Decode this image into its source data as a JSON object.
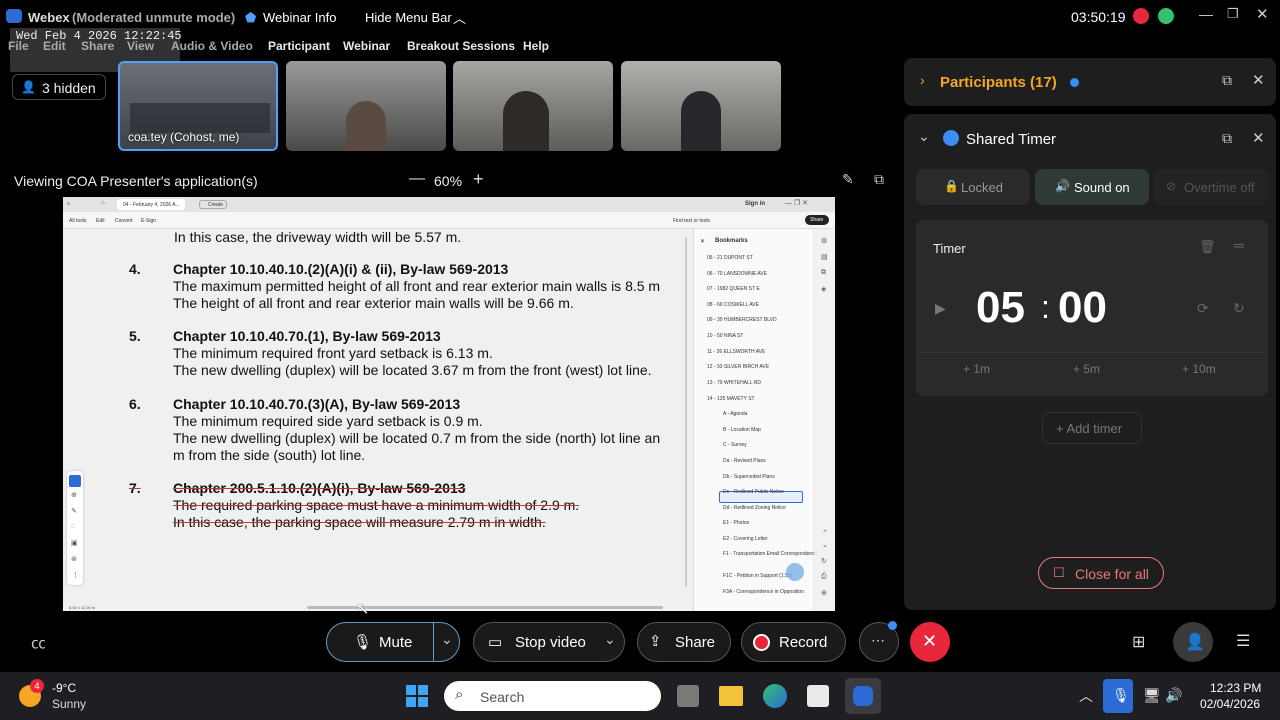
{
  "titlebar": {
    "app": "Webex",
    "mode": "(Moderated unmute mode)",
    "datetime": "Wed Feb 4 2026 12:22:45",
    "webinar_info": "Webinar Info",
    "hide_menu": "Hide Menu Bar",
    "timer": "03:50:19"
  },
  "menu": [
    "File",
    "Edit",
    "Share",
    "View",
    "Audio & Video",
    "Participant",
    "Webinar",
    "Breakout Sessions",
    "Help"
  ],
  "hidden_count": "3 hidden",
  "thumbs": [
    {
      "label": "coa.tey (Cohost, me)"
    }
  ],
  "share": {
    "viewing": "Viewing COA Presenter's application(s)",
    "zoom": "60%"
  },
  "doc": {
    "tab": "04 - February 4, 2026 A...",
    "create": "Create",
    "sign_in": "Sign in",
    "tools": [
      "All tools",
      "Edit",
      "Convert",
      "E-Sign"
    ],
    "find": "Find text or tools",
    "share": "Share",
    "bookmarks_title": "Bookmarks",
    "bookmarks": [
      "05 - 21 DUPONT ST",
      "06 - 70 LANSDOWNE AVE",
      "07 - 1982 QUEEN ST E",
      "08 - 69 COSWELL AVE",
      "09 - 39 HUMBERCREST BLVD",
      "10 - 50 NINA ST",
      "11 - 26 ELLSWORTH AVE",
      "12 - 93 SILVER BIRCH AVE",
      "13 - 79 WHITEHALL RD",
      "14 - 135 MAVETY ST",
      "A - Agenda",
      "B - Location Map",
      "C - Survey",
      "Da - Revised Plans",
      "Db - Superceded Plans",
      "Dc - Redlined Public Notice",
      "Dd - Redlined Zoning Notice",
      "E1 - Photos",
      "E2 - Covering Letter",
      "F1 - Transportation Email Correspondence",
      "F1C - Petition in Support (1.50)",
      "F3A - Correspondence in Opposition"
    ],
    "status": "8.50 x 11.00 in",
    "lines": {
      "l0": "In this case, the driveway width will be 5.57 m.",
      "n4": "4.",
      "h4": "Chapter 10.10.40.10.(2)(A)(i) & (ii), By-law 569-2013",
      "t4a": "The maximum permitted height of all front and rear exterior main walls is 8.5 m",
      "t4b": "The height of all front and rear exterior main walls will be 9.66 m.",
      "n5": "5.",
      "h5": "Chapter 10.10.40.70.(1), By-law 569-2013",
      "t5a": "The minimum required front yard setback is 6.13 m.",
      "t5b": "The new dwelling (duplex) will be located 3.67 m from the front (west) lot line.",
      "n6": "6.",
      "h6": "Chapter 10.10.40.70.(3)(A), By-law 569-2013",
      "t6a": "The minimum required side yard setback is 0.9 m.",
      "t6b": "The new dwelling (duplex) will be located 0.7 m from the side (north) lot line an",
      "t6c": "m from the side (south) lot line.",
      "n7": "7.",
      "h7": "Chapter 200.5.1.10.(2)(A)(i), By-law 569-2013",
      "t7a": "The required parking space must have a minimum width of 2.9 m.",
      "t7b": "In this case, the parking space will measure 2.79 m in width."
    }
  },
  "participants": {
    "label": "Participants (17)"
  },
  "timer_panel": {
    "title": "Shared Timer",
    "locked": "Locked",
    "sound_on": "Sound on",
    "overtime_off": "Overtime off",
    "timer_label": "Timer",
    "minutes": "05",
    "seconds": "00",
    "add1": "+ 1m",
    "add5": "+ 5m",
    "add10": "+ 10m",
    "add_timer": "+ Add timer",
    "close_all": "Close for all"
  },
  "controls": {
    "mute": "Mute",
    "stop_video": "Stop video",
    "share": "Share",
    "record": "Record"
  },
  "taskbar": {
    "temp": "-9°C",
    "weather": "Sunny",
    "badge": "4",
    "search": "Search",
    "time": "12:23 PM",
    "date": "02/04/2026"
  },
  "colors": {
    "accent_orange": "#f5a623",
    "record_red": "#e8283a",
    "sound_green": "#35c06b",
    "blue_dot": "#3a8ef6"
  }
}
